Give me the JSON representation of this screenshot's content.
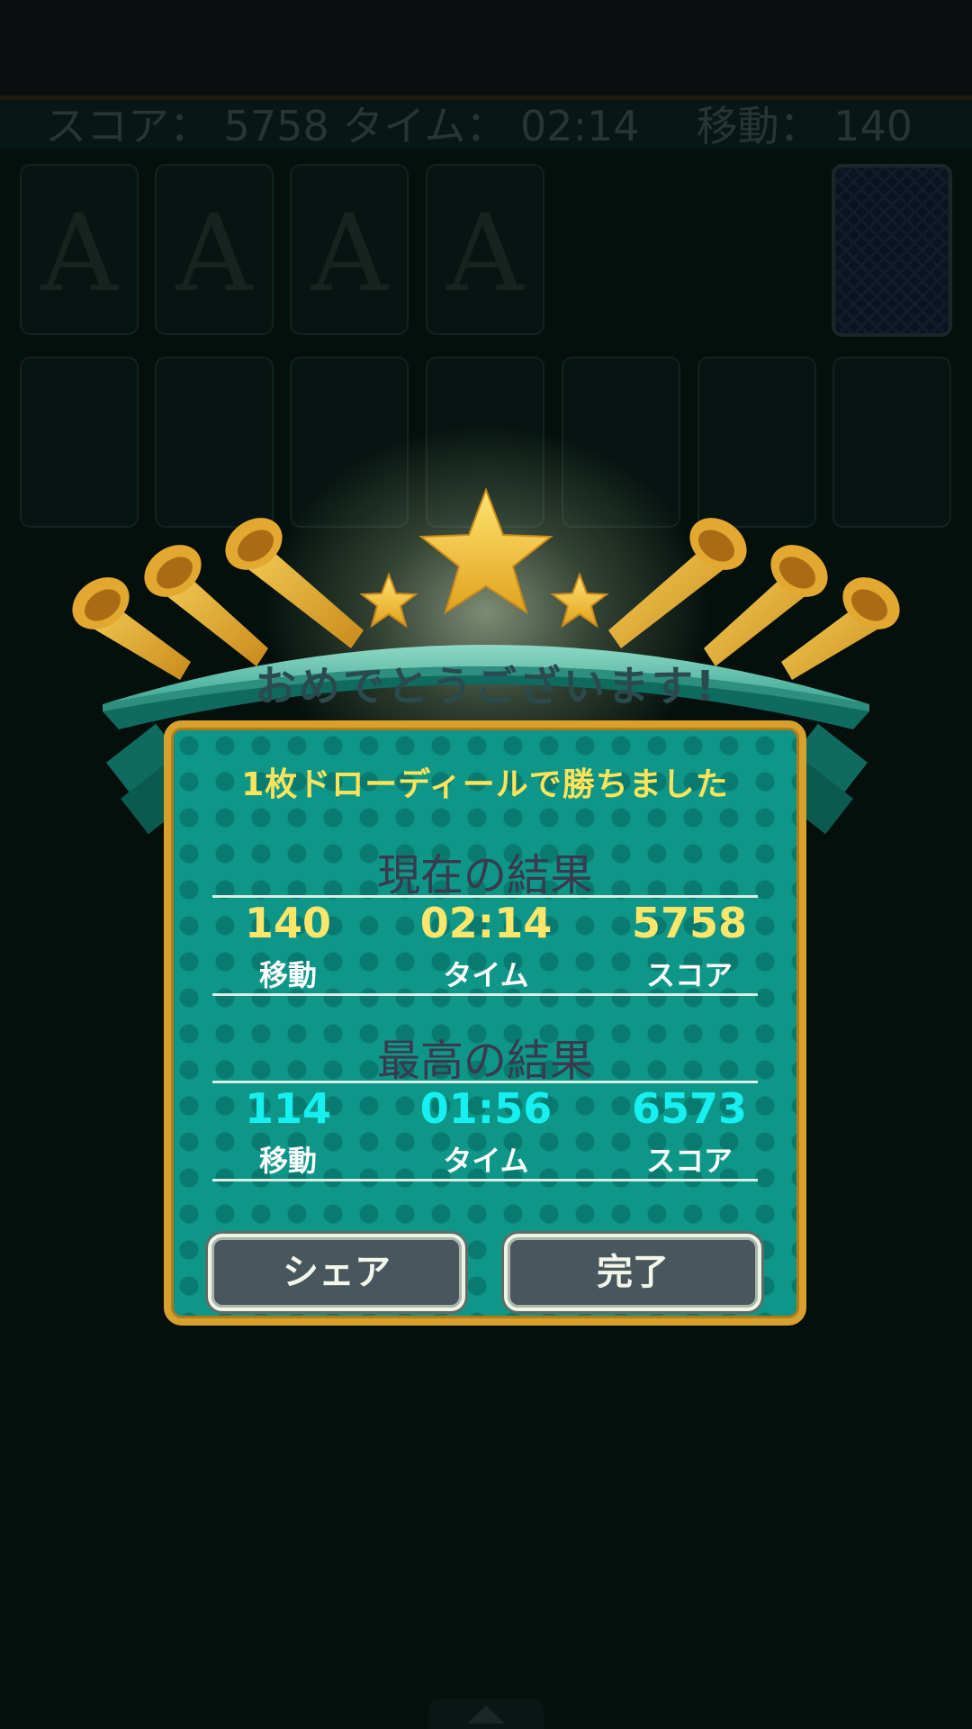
{
  "status_bar": {
    "left_text": "スコア： 5758 タイム： 02:14",
    "right_text": "移動： 140"
  },
  "foundations": [
    {
      "label": "A"
    },
    {
      "label": "A"
    },
    {
      "label": "A"
    },
    {
      "label": "A"
    }
  ],
  "dialog": {
    "banner_title": "おめでとうございます!",
    "subtitle": "1枚ドローディールで勝ちました",
    "current": {
      "title": "現在の結果",
      "moves": "140",
      "moves_label": "移動",
      "time": "02:14",
      "time_label": "タイム",
      "score": "5758",
      "score_label": "スコア"
    },
    "best": {
      "title": "最高の結果",
      "moves": "114",
      "moves_label": "移動",
      "time": "01:56",
      "time_label": "タイム",
      "score": "6573",
      "score_label": "スコア"
    },
    "share_button": "シェア",
    "done_button": "完了"
  },
  "colors": {
    "panel": "#0e9688",
    "border_gold": "#d8a02d",
    "current_values": "#fde66a",
    "best_values": "#17f0f0",
    "button": "#48575e"
  }
}
